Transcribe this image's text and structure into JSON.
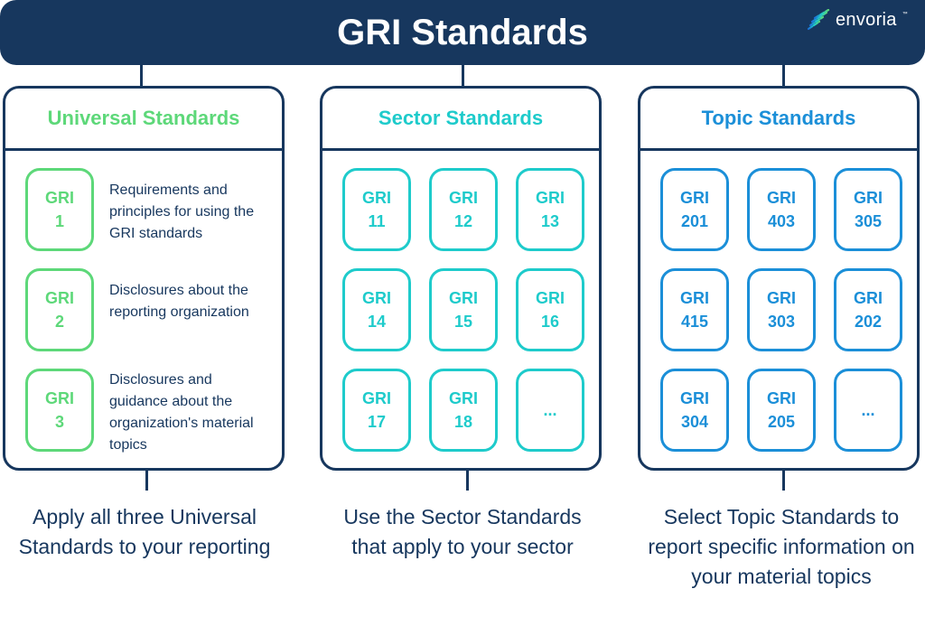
{
  "header": {
    "title": "GRI Standards",
    "logo_text": "envoria",
    "logo_tm": "™",
    "logo_icon": "envoria-stripes-icon"
  },
  "colors": {
    "navy": "#17375e",
    "universal": "#5dd879",
    "sector": "#1ecbcb",
    "topic": "#1b8fd8"
  },
  "universal": {
    "title": "Universal Standards",
    "items": [
      {
        "line1": "GRI",
        "line2": "1",
        "description": "Requirements and principles for using the GRI standards"
      },
      {
        "line1": "GRI",
        "line2": "2",
        "description": "Disclosures about the reporting organization"
      },
      {
        "line1": "GRI",
        "line2": "3",
        "description": "Disclosures and guidance about the organization's material topics"
      }
    ],
    "caption": "Apply all three Universal Standards to your reporting"
  },
  "sector": {
    "title": "Sector Standards",
    "tiles": [
      {
        "line1": "GRI",
        "line2": "11"
      },
      {
        "line1": "GRI",
        "line2": "12"
      },
      {
        "line1": "GRI",
        "line2": "13"
      },
      {
        "line1": "GRI",
        "line2": "14"
      },
      {
        "line1": "GRI",
        "line2": "15"
      },
      {
        "line1": "GRI",
        "line2": "16"
      },
      {
        "line1": "GRI",
        "line2": "17"
      },
      {
        "line1": "GRI",
        "line2": "18"
      },
      {
        "line1": "...",
        "line2": ""
      }
    ],
    "caption": "Use the Sector Standards that apply to your sector"
  },
  "topic": {
    "title": "Topic Standards",
    "tiles": [
      {
        "line1": "GRI",
        "line2": "201"
      },
      {
        "line1": "GRI",
        "line2": "403"
      },
      {
        "line1": "GRI",
        "line2": "305"
      },
      {
        "line1": "GRI",
        "line2": "415"
      },
      {
        "line1": "GRI",
        "line2": "303"
      },
      {
        "line1": "GRI",
        "line2": "202"
      },
      {
        "line1": "GRI",
        "line2": "304"
      },
      {
        "line1": "GRI",
        "line2": "205"
      },
      {
        "line1": "...",
        "line2": ""
      }
    ],
    "caption": "Select Topic Standards to report specific information on your material topics"
  }
}
